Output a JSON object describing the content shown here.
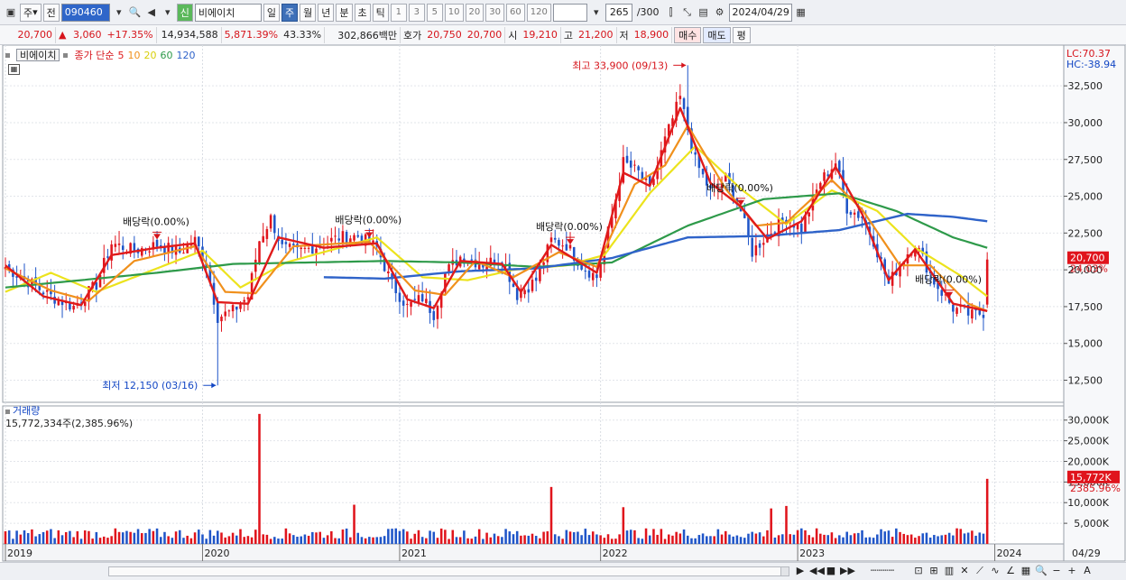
{
  "toolbar": {
    "period_type": "주",
    "prev_label": "전",
    "code": "090460",
    "credit_badge": "신",
    "stock_name": "비에이치",
    "periods": [
      "일",
      "주",
      "월",
      "년",
      "분",
      "초",
      "틱"
    ],
    "selected_period": "주",
    "intervals": [
      "1",
      "3",
      "5",
      "10",
      "20",
      "30",
      "60",
      "120"
    ],
    "count": "265",
    "max_count": "/300",
    "date": "2024/04/29"
  },
  "quote": {
    "price": "20,700",
    "change_arrow": "▲",
    "change": "3,060",
    "change_pct": "+17.35%",
    "volume": "14,934,588",
    "volume_ratio": "5,871.39%",
    "turnover": "43.33%",
    "amount": "302,866백만",
    "bid_label": "호가",
    "ask": "20,750",
    "bid": "20,700",
    "open_label": "시",
    "open": "19,210",
    "high_label": "고",
    "high": "21,200",
    "low_label": "저",
    "low": "18,900",
    "buy_button": "매수",
    "sell_button": "매도",
    "eval_button": "평"
  },
  "legend": {
    "name": "비에이치",
    "price_type": "종가 단순",
    "ma": [
      {
        "label": "5",
        "color": "#e01b1b"
      },
      {
        "label": "10",
        "color": "#f0901c"
      },
      {
        "label": "20",
        "color": "#e8df1a"
      },
      {
        "label": "60",
        "color": "#2e9a4a"
      },
      {
        "label": "120",
        "color": "#2f63c9"
      }
    ]
  },
  "right_labels": {
    "lc": "LC:70.37",
    "hc": "HC:-38.94",
    "price_tag": "20,700",
    "pct_tag": "24.03%",
    "vol_tag": "15,772K",
    "vol_pct_tag": "2385.96%"
  },
  "annotations": {
    "high": "최고 33,900 (09/13)",
    "low": "최저 12,150 (03/16)",
    "dividend_1": "배당락(0.00%)",
    "dividend_2": "배당락(0.00%)",
    "dividend_3": "배당락(0.00%)",
    "dividend_4": "배당락(0.00%)",
    "dividend_5": "배당락(0.00%)"
  },
  "volume_panel": {
    "title": "거래량",
    "value": "15,772,334주(2,385.96%)"
  },
  "chart_data": {
    "type": "candlestick",
    "price_axis": {
      "ticks": [
        "32,500",
        "30,000",
        "27,500",
        "25,000",
        "22,500",
        "20,000",
        "17,500",
        "15,000",
        "12,500"
      ],
      "tick_values": [
        32500,
        30000,
        27500,
        25000,
        22500,
        20000,
        17500,
        15000,
        12500
      ],
      "range": [
        11000,
        34900
      ]
    },
    "volume_axis": {
      "ticks": [
        "30,000K",
        "25,000K",
        "20,000K",
        "15,000K",
        "10,000K",
        "5,000K"
      ],
      "tick_values": [
        30000,
        25000,
        20000,
        15000,
        10000,
        5000
      ],
      "range": [
        0,
        33000
      ]
    },
    "x_labels": [
      "2019",
      "2020",
      "2021",
      "2022",
      "2023",
      "2024",
      "04/29"
    ],
    "x_label_weeks": [
      0,
      52,
      104,
      157,
      209,
      261,
      278
    ],
    "weeks": 278,
    "close_anchors": [
      [
        0,
        20200
      ],
      [
        6,
        19200
      ],
      [
        12,
        18200
      ],
      [
        18,
        17500
      ],
      [
        24,
        19000
      ],
      [
        28,
        21800
      ],
      [
        34,
        21300
      ],
      [
        40,
        21700
      ],
      [
        46,
        21200
      ],
      [
        50,
        22000
      ],
      [
        53,
        20400
      ],
      [
        56,
        16800
      ],
      [
        60,
        17200
      ],
      [
        64,
        18200
      ],
      [
        67,
        22000
      ],
      [
        70,
        23500
      ],
      [
        73,
        21500
      ],
      [
        77,
        21200
      ],
      [
        82,
        21600
      ],
      [
        88,
        22200
      ],
      [
        93,
        22300
      ],
      [
        98,
        21500
      ],
      [
        102,
        19000
      ],
      [
        106,
        17500
      ],
      [
        110,
        18100
      ],
      [
        113,
        17000
      ],
      [
        116,
        19800
      ],
      [
        120,
        20900
      ],
      [
        126,
        20400
      ],
      [
        131,
        20800
      ],
      [
        135,
        18300
      ],
      [
        140,
        19300
      ],
      [
        144,
        22000
      ],
      [
        148,
        21700
      ],
      [
        152,
        20300
      ],
      [
        156,
        19500
      ],
      [
        160,
        23600
      ],
      [
        163,
        27300
      ],
      [
        167,
        26600
      ],
      [
        170,
        25400
      ],
      [
        174,
        28800
      ],
      [
        178,
        31700
      ],
      [
        182,
        27400
      ],
      [
        186,
        25300
      ],
      [
        190,
        26200
      ],
      [
        194,
        24000
      ],
      [
        197,
        21200
      ],
      [
        201,
        22400
      ],
      [
        206,
        23500
      ],
      [
        210,
        22800
      ],
      [
        215,
        26000
      ],
      [
        219,
        27300
      ],
      [
        222,
        24200
      ],
      [
        226,
        23600
      ],
      [
        229,
        22000
      ],
      [
        233,
        19000
      ],
      [
        236,
        20500
      ],
      [
        240,
        21800
      ],
      [
        245,
        19200
      ],
      [
        250,
        17400
      ],
      [
        255,
        16900
      ],
      [
        258,
        17100
      ],
      [
        259,
        20700
      ]
    ],
    "ma_lines": {
      "ma5": [
        [
          0,
          20300
        ],
        [
          10,
          18200
        ],
        [
          20,
          17600
        ],
        [
          28,
          21000
        ],
        [
          40,
          21500
        ],
        [
          50,
          21800
        ],
        [
          56,
          17800
        ],
        [
          64,
          17700
        ],
        [
          72,
          22200
        ],
        [
          84,
          21500
        ],
        [
          98,
          21800
        ],
        [
          106,
          18000
        ],
        [
          113,
          17400
        ],
        [
          120,
          20600
        ],
        [
          131,
          20400
        ],
        [
          136,
          18500
        ],
        [
          144,
          21700
        ],
        [
          156,
          19800
        ],
        [
          163,
          26600
        ],
        [
          170,
          25700
        ],
        [
          178,
          31000
        ],
        [
          186,
          25900
        ],
        [
          194,
          24300
        ],
        [
          201,
          22100
        ],
        [
          210,
          23300
        ],
        [
          219,
          27000
        ],
        [
          226,
          23800
        ],
        [
          233,
          19300
        ],
        [
          240,
          21400
        ],
        [
          250,
          17700
        ],
        [
          259,
          17200
        ]
      ],
      "ma10": [
        [
          0,
          20100
        ],
        [
          12,
          18600
        ],
        [
          22,
          17900
        ],
        [
          34,
          20600
        ],
        [
          50,
          21600
        ],
        [
          58,
          18500
        ],
        [
          66,
          18400
        ],
        [
          76,
          21600
        ],
        [
          96,
          21900
        ],
        [
          108,
          18600
        ],
        [
          116,
          18300
        ],
        [
          124,
          20600
        ],
        [
          134,
          19500
        ],
        [
          146,
          21200
        ],
        [
          156,
          20200
        ],
        [
          166,
          25800
        ],
        [
          174,
          27100
        ],
        [
          180,
          29800
        ],
        [
          190,
          25500
        ],
        [
          198,
          23000
        ],
        [
          206,
          23200
        ],
        [
          218,
          26100
        ],
        [
          226,
          24100
        ],
        [
          236,
          20300
        ],
        [
          244,
          20300
        ],
        [
          254,
          17700
        ],
        [
          259,
          17200
        ]
      ],
      "ma20": [
        [
          0,
          18500
        ],
        [
          12,
          19800
        ],
        [
          24,
          18500
        ],
        [
          36,
          19700
        ],
        [
          52,
          21300
        ],
        [
          62,
          18800
        ],
        [
          74,
          20500
        ],
        [
          98,
          22200
        ],
        [
          110,
          19500
        ],
        [
          122,
          19300
        ],
        [
          134,
          20000
        ],
        [
          148,
          20300
        ],
        [
          158,
          21000
        ],
        [
          170,
          25200
        ],
        [
          182,
          28400
        ],
        [
          194,
          25500
        ],
        [
          206,
          23100
        ],
        [
          218,
          25400
        ],
        [
          230,
          24000
        ],
        [
          240,
          21500
        ],
        [
          252,
          19600
        ],
        [
          259,
          18200
        ]
      ],
      "ma60": [
        [
          0,
          18800
        ],
        [
          20,
          19300
        ],
        [
          40,
          19800
        ],
        [
          60,
          20400
        ],
        [
          80,
          20500
        ],
        [
          100,
          20600
        ],
        [
          120,
          20500
        ],
        [
          140,
          20200
        ],
        [
          160,
          20500
        ],
        [
          180,
          23000
        ],
        [
          200,
          24800
        ],
        [
          220,
          25200
        ],
        [
          235,
          24000
        ],
        [
          250,
          22200
        ],
        [
          259,
          21500
        ]
      ],
      "ma120": [
        [
          84,
          19500
        ],
        [
          100,
          19400
        ],
        [
          120,
          19900
        ],
        [
          140,
          20100
        ],
        [
          160,
          20800
        ],
        [
          180,
          22200
        ],
        [
          200,
          22300
        ],
        [
          220,
          22700
        ],
        [
          238,
          23800
        ],
        [
          250,
          23600
        ],
        [
          259,
          23300
        ]
      ]
    },
    "high_point": {
      "week": 180,
      "value": 33900
    },
    "low_point": {
      "week": 56,
      "value": 12150
    },
    "dividend_weeks": [
      40,
      96,
      149,
      194,
      249
    ],
    "volume_spikes": [
      [
        67,
        31500
      ],
      [
        92,
        9500
      ],
      [
        144,
        13800
      ],
      [
        163,
        8900
      ],
      [
        202,
        8600
      ],
      [
        206,
        9200
      ],
      [
        259,
        15772
      ]
    ],
    "last_volume_bar": 15772
  }
}
